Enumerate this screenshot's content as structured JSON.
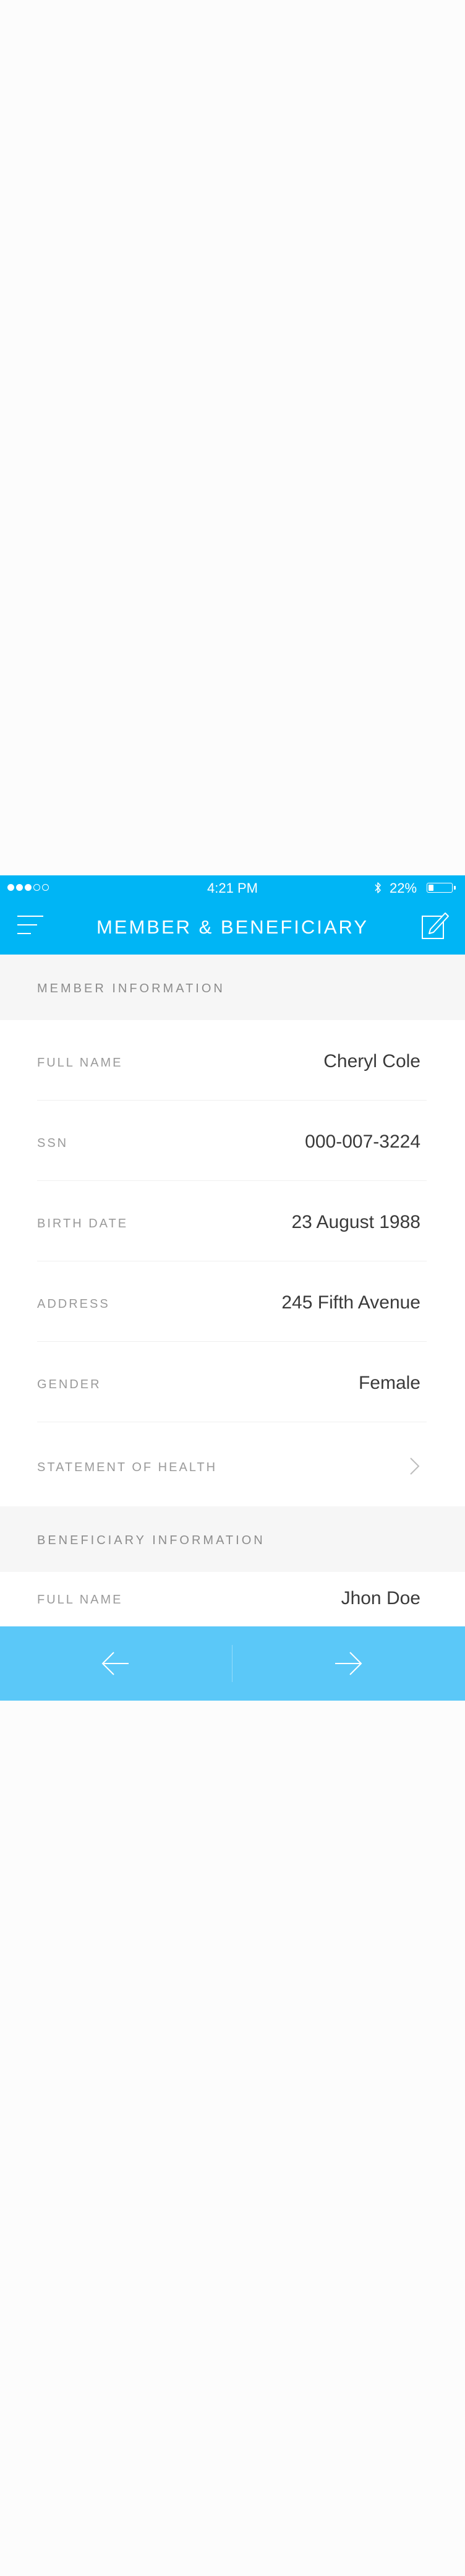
{
  "status_bar": {
    "time": "4:21 PM",
    "battery_percent": "22%",
    "battery_level": 0.22,
    "signal_bars_filled": 3,
    "signal_bars_total": 5
  },
  "header": {
    "title": "MEMBER & BENEFICIARY",
    "background_color": "#00b5f5",
    "icons": {
      "menu": "hamburger-menu-icon",
      "edit": "edit-compose-icon"
    }
  },
  "member_section": {
    "title": "MEMBER INFORMATION",
    "rows": [
      {
        "label": "FULL NAME",
        "value": "Cheryl Cole"
      },
      {
        "label": "SSN",
        "value": "000-007-3224"
      },
      {
        "label": "BIRTH DATE",
        "value": "23 August 1988"
      },
      {
        "label": "ADDRESS",
        "value": "245 Fifth Avenue"
      },
      {
        "label": "GENDER",
        "value": "Female"
      }
    ],
    "health_link": {
      "label": "STATEMENT OF HEALTH",
      "icon": "chevron-right-icon"
    }
  },
  "beneficiary_section": {
    "title": "BENEFICIARY INFORMATION",
    "rows": [
      {
        "label": "FULL NAME",
        "value": "Jhon Doe"
      }
    ]
  },
  "footer": {
    "background_color": "#5bc8f8",
    "icons": {
      "back": "arrow-left-icon",
      "forward": "arrow-right-icon"
    }
  }
}
